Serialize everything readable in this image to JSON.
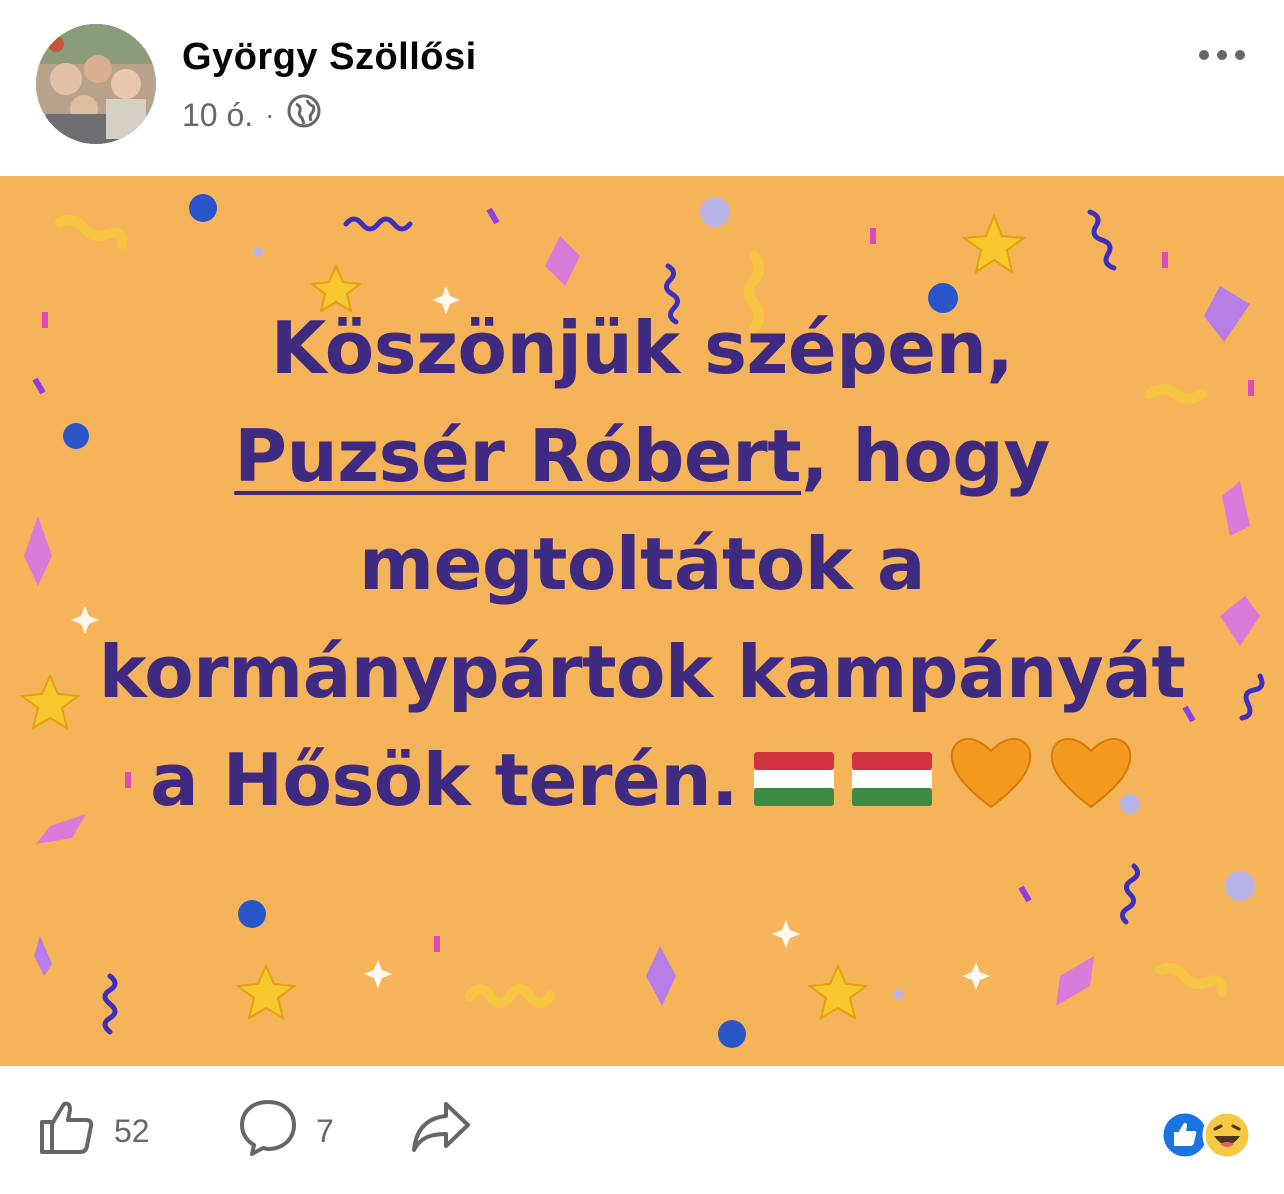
{
  "post": {
    "author": "György Szöllősi",
    "time": "10 ó.",
    "separator": "·",
    "privacy_icon": "globe-icon",
    "text_before": "Köszönjük szépen,",
    "mention": "Puzsér Róbert",
    "text_after": ", hogy megtoltátok a kormánypártok kampányát a Hősök terén.",
    "emojis": [
      "hungarian-flag",
      "hungarian-flag",
      "orange-heart",
      "orange-heart"
    ],
    "background_color": "#f6b45a",
    "text_color": "#3f2a82"
  },
  "footer": {
    "likes": "52",
    "comments": "7",
    "like_icon": "thumbs-up-icon",
    "comment_icon": "comment-bubble-icon",
    "share_icon": "share-arrow-icon",
    "reaction_icons": [
      "like-reaction-icon",
      "haha-reaction-icon"
    ]
  }
}
